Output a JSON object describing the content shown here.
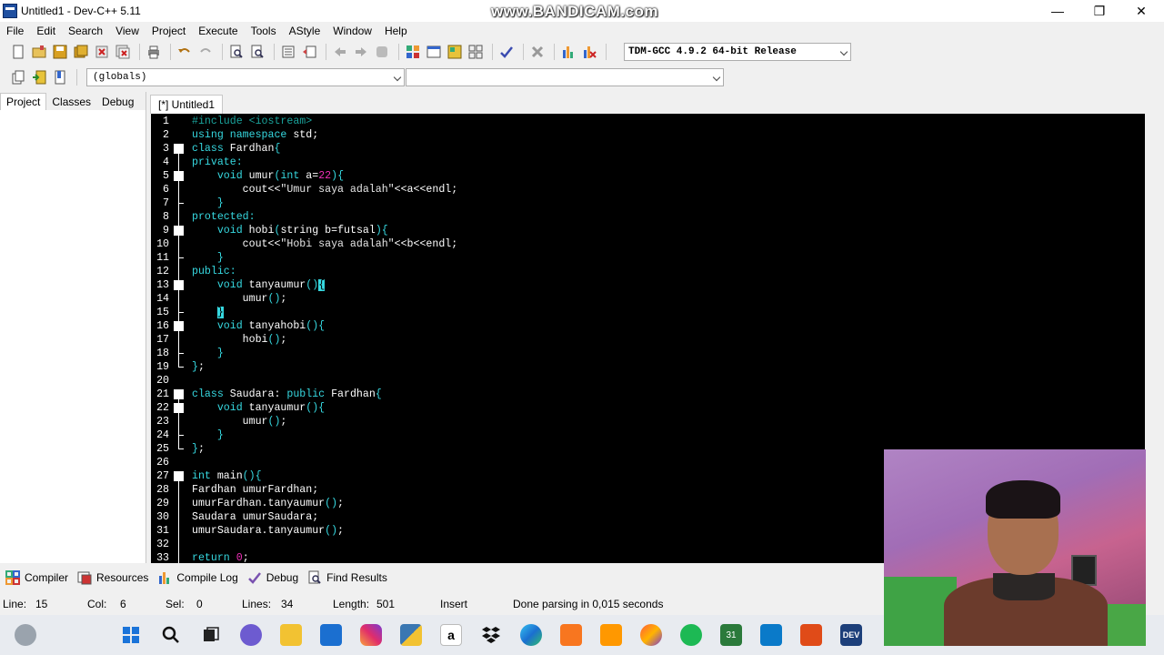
{
  "window": {
    "title": "Untitled1 - Dev-C++ 5.11",
    "watermark": "www.BANDICAM.com",
    "controls": [
      "minimize",
      "maximize",
      "close"
    ]
  },
  "menu": [
    "File",
    "Edit",
    "Search",
    "View",
    "Project",
    "Execute",
    "Tools",
    "AStyle",
    "Window",
    "Help"
  ],
  "toolbar": {
    "compiler": "TDM-GCC 4.9.2 64-bit Release",
    "scope": "(globals)"
  },
  "left_panel": {
    "tabs": [
      "Project",
      "Classes",
      "Debug"
    ]
  },
  "editor": {
    "tab": "[*] Untitled1",
    "lines": [
      {
        "n": "1",
        "tokens": [
          [
            "pre",
            "#include <iostream>"
          ]
        ]
      },
      {
        "n": "2",
        "tokens": [
          [
            "kw",
            "using"
          ],
          [
            "op",
            " "
          ],
          [
            "kw",
            "namespace"
          ],
          [
            "op",
            " std;"
          ]
        ]
      },
      {
        "n": "3",
        "tokens": [
          [
            "kw",
            "class"
          ],
          [
            "op",
            " Fardhan"
          ],
          [
            "br",
            "{"
          ]
        ]
      },
      {
        "n": "4",
        "tokens": [
          [
            "kw",
            "private:"
          ]
        ]
      },
      {
        "n": "5",
        "tokens": [
          [
            "op",
            "    "
          ],
          [
            "kw",
            "void"
          ],
          [
            "op",
            " umur"
          ],
          [
            "br",
            "("
          ],
          [
            "kw",
            "int"
          ],
          [
            "op",
            " a="
          ],
          [
            "num",
            "22"
          ],
          [
            "br",
            "){"
          ]
        ]
      },
      {
        "n": "6",
        "tokens": [
          [
            "op",
            "        cout<<"
          ],
          [
            "str",
            "\"Umur saya adalah\""
          ],
          [
            "op",
            "<<a<<endl;"
          ]
        ]
      },
      {
        "n": "7",
        "tokens": [
          [
            "op",
            "    "
          ],
          [
            "br",
            "}"
          ]
        ]
      },
      {
        "n": "8",
        "tokens": [
          [
            "kw",
            "protected:"
          ]
        ]
      },
      {
        "n": "9",
        "tokens": [
          [
            "op",
            "    "
          ],
          [
            "kw",
            "void"
          ],
          [
            "op",
            " hobi"
          ],
          [
            "br",
            "("
          ],
          [
            "op",
            "string b=futsal"
          ],
          [
            "br",
            "){"
          ]
        ]
      },
      {
        "n": "10",
        "tokens": [
          [
            "op",
            "        cout<<"
          ],
          [
            "str",
            "\"Hobi saya adalah\""
          ],
          [
            "op",
            "<<b<<endl;"
          ]
        ]
      },
      {
        "n": "11",
        "tokens": [
          [
            "op",
            "    "
          ],
          [
            "br",
            "}"
          ]
        ]
      },
      {
        "n": "12",
        "tokens": [
          [
            "kw",
            "public:"
          ]
        ]
      },
      {
        "n": "13",
        "tokens": [
          [
            "op",
            "    "
          ],
          [
            "kw",
            "void"
          ],
          [
            "op",
            " tanyaumur"
          ],
          [
            "br",
            "()"
          ],
          [
            "hl",
            "{"
          ]
        ]
      },
      {
        "n": "14",
        "tokens": [
          [
            "op",
            "        umur"
          ],
          [
            "br",
            "()"
          ],
          [
            "op",
            ";"
          ]
        ]
      },
      {
        "n": "15",
        "tokens": [
          [
            "op",
            "    "
          ],
          [
            "hl",
            "}"
          ]
        ]
      },
      {
        "n": "16",
        "tokens": [
          [
            "op",
            "    "
          ],
          [
            "kw",
            "void"
          ],
          [
            "op",
            " tanyahobi"
          ],
          [
            "br",
            "(){"
          ]
        ]
      },
      {
        "n": "17",
        "tokens": [
          [
            "op",
            "        hobi"
          ],
          [
            "br",
            "()"
          ],
          [
            "op",
            ";"
          ]
        ]
      },
      {
        "n": "18",
        "tokens": [
          [
            "op",
            "    "
          ],
          [
            "br",
            "}"
          ]
        ]
      },
      {
        "n": "19",
        "tokens": [
          [
            "br",
            "}"
          ],
          [
            "op",
            ";"
          ]
        ]
      },
      {
        "n": "20",
        "tokens": []
      },
      {
        "n": "21",
        "tokens": [
          [
            "kw",
            "class"
          ],
          [
            "op",
            " Saudara: "
          ],
          [
            "kw",
            "public"
          ],
          [
            "op",
            " Fardhan"
          ],
          [
            "br",
            "{"
          ]
        ]
      },
      {
        "n": "22",
        "tokens": [
          [
            "op",
            "    "
          ],
          [
            "kw",
            "void"
          ],
          [
            "op",
            " tanyaumur"
          ],
          [
            "br",
            "(){"
          ]
        ]
      },
      {
        "n": "23",
        "tokens": [
          [
            "op",
            "        umur"
          ],
          [
            "br",
            "()"
          ],
          [
            "op",
            ";"
          ]
        ]
      },
      {
        "n": "24",
        "tokens": [
          [
            "op",
            "    "
          ],
          [
            "br",
            "}"
          ]
        ]
      },
      {
        "n": "25",
        "tokens": [
          [
            "br",
            "}"
          ],
          [
            "op",
            ";"
          ]
        ]
      },
      {
        "n": "26",
        "tokens": []
      },
      {
        "n": "27",
        "tokens": [
          [
            "kw",
            "int"
          ],
          [
            "op",
            " main"
          ],
          [
            "br",
            "(){"
          ]
        ]
      },
      {
        "n": "28",
        "tokens": [
          [
            "op",
            "Fardhan umurFardhan;"
          ]
        ]
      },
      {
        "n": "29",
        "tokens": [
          [
            "op",
            "umurFardhan.tanyaumur"
          ],
          [
            "br",
            "()"
          ],
          [
            "op",
            ";"
          ]
        ]
      },
      {
        "n": "30",
        "tokens": [
          [
            "op",
            "Saudara umurSaudara;"
          ]
        ]
      },
      {
        "n": "31",
        "tokens": [
          [
            "op",
            "umurSaudara.tanyaumur"
          ],
          [
            "br",
            "()"
          ],
          [
            "op",
            ";"
          ]
        ]
      },
      {
        "n": "32",
        "tokens": []
      },
      {
        "n": "33",
        "tokens": [
          [
            "kw",
            "return"
          ],
          [
            "op",
            " "
          ],
          [
            "num",
            "0"
          ],
          [
            "op",
            ";"
          ]
        ]
      }
    ],
    "fold_markers": [
      "3",
      "5",
      "9",
      "13",
      "16",
      "21",
      "22",
      "27"
    ]
  },
  "bottom_tabs": [
    "Compiler",
    "Resources",
    "Compile Log",
    "Debug",
    "Find Results"
  ],
  "status": {
    "line_label": "Line:",
    "line_value": "15",
    "col_label": "Col:",
    "col_value": "6",
    "sel_label": "Sel:",
    "sel_value": "0",
    "lines_label": "Lines:",
    "lines_value": "34",
    "length_label": "Length:",
    "length_value": "501",
    "mode": "Insert",
    "message": "Done parsing in 0,015 seconds"
  },
  "taskbar_icons": [
    "windows-start",
    "search",
    "task-view",
    "chat",
    "file-explorer",
    "store",
    "instagram",
    "python",
    "amazon",
    "dropbox",
    "edge",
    "xampp",
    "sublime",
    "firefox",
    "spotify",
    "calendar",
    "vscode",
    "office",
    "devcpp"
  ],
  "colors": {
    "editor_bg": "#000000",
    "keyword": "#36d8e0",
    "number": "#ef2fb8",
    "preprocessor": "#1aa29b"
  }
}
